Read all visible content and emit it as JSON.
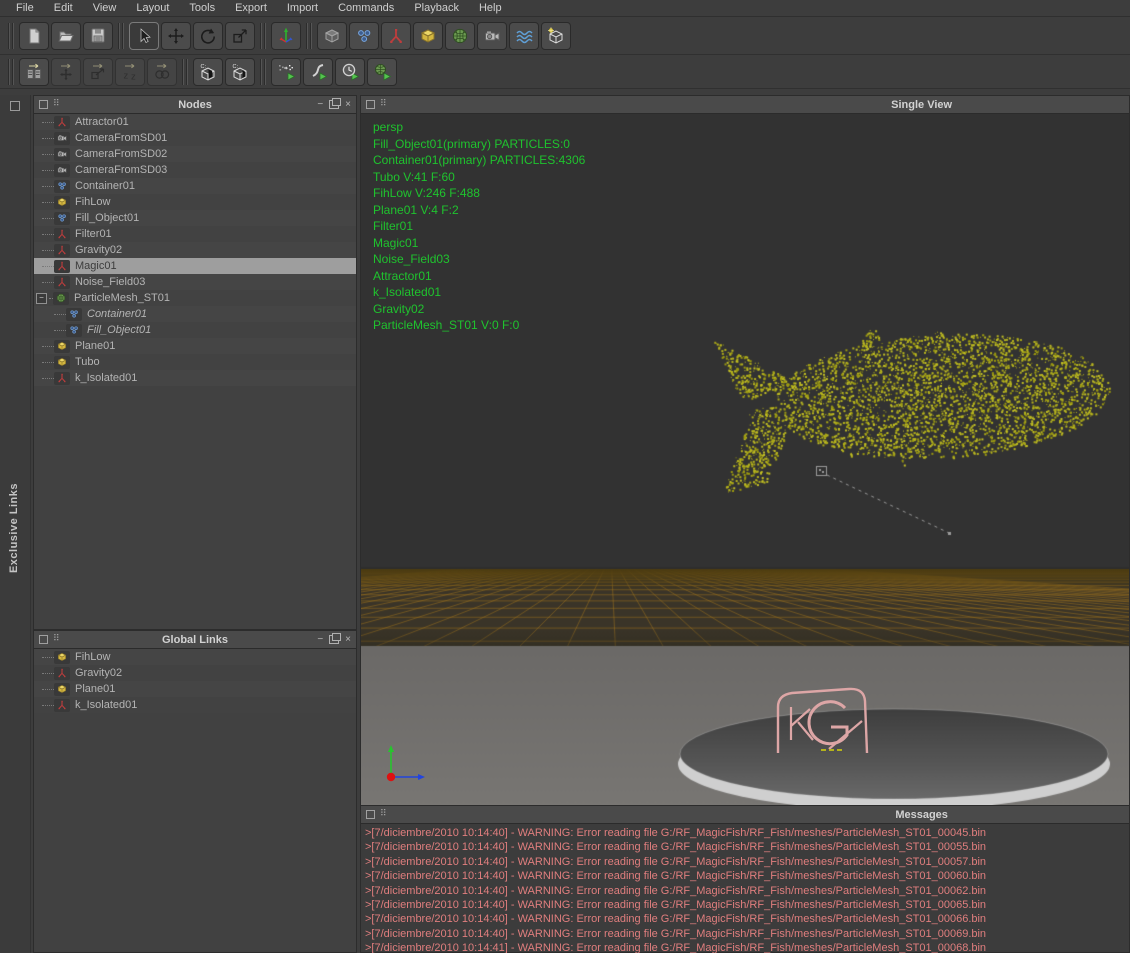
{
  "menu": {
    "items": [
      "File",
      "Edit",
      "View",
      "Layout",
      "Tools",
      "Export",
      "Import",
      "Commands",
      "Playback",
      "Help"
    ]
  },
  "toolbar_row1": {
    "groups": [
      {
        "buttons": [
          {
            "icon": "new-page",
            "name": "new-scene"
          },
          {
            "icon": "open-folder",
            "name": "open-scene"
          },
          {
            "icon": "save",
            "name": "save-scene"
          }
        ]
      },
      {
        "buttons": [
          {
            "icon": "select",
            "name": "select-tool",
            "pressed": true
          },
          {
            "icon": "move",
            "name": "move-tool"
          },
          {
            "icon": "rotate",
            "name": "rotate-tool"
          },
          {
            "icon": "scale",
            "name": "scale-tool"
          }
        ]
      },
      {
        "buttons": [
          {
            "icon": "axes",
            "name": "gizmo-tool"
          }
        ]
      },
      {
        "buttons": [
          {
            "icon": "cube-gray",
            "name": "add-null"
          },
          {
            "icon": "particles",
            "name": "add-particles"
          },
          {
            "icon": "daemon",
            "name": "add-daemon"
          },
          {
            "icon": "cube-yellow",
            "name": "add-object"
          },
          {
            "icon": "sphere-green",
            "name": "add-mesh"
          },
          {
            "icon": "camera",
            "name": "add-camera"
          },
          {
            "icon": "waves",
            "name": "add-realwave"
          },
          {
            "icon": "cube-wire",
            "name": "add-domain"
          }
        ]
      }
    ]
  },
  "toolbar_row2": {
    "groups": [
      {
        "buttons": [
          {
            "icon": "copy-table",
            "name": "copy-table"
          },
          {
            "icon": "copy-move",
            "name": "copy-move",
            "disabled": true
          },
          {
            "icon": "copy-scale",
            "name": "copy-scale",
            "disabled": true
          },
          {
            "icon": "copy-zz",
            "name": "copy-z",
            "disabled": true
          },
          {
            "icon": "copy-circles",
            "name": "copy-rings",
            "disabled": true
          }
        ]
      },
      {
        "buttons": [
          {
            "icon": "cache1",
            "name": "cache-left"
          },
          {
            "icon": "cache2",
            "name": "cache-right"
          }
        ]
      },
      {
        "buttons": [
          {
            "icon": "sim-parts",
            "name": "simulate-particles"
          },
          {
            "icon": "sim-curve",
            "name": "simulate-curve"
          },
          {
            "icon": "sim-clock",
            "name": "simulate-timed"
          },
          {
            "icon": "sim-mesh",
            "name": "simulate-mesh"
          }
        ]
      }
    ]
  },
  "side": {
    "exclusive_links_label": "Exclusive Links"
  },
  "nodes_panel": {
    "title": "Nodes",
    "items": [
      {
        "label": "Attractor01",
        "icon": "daemon"
      },
      {
        "label": "CameraFromSD01",
        "icon": "camera"
      },
      {
        "label": "CameraFromSD02",
        "icon": "camera"
      },
      {
        "label": "CameraFromSD03",
        "icon": "camera"
      },
      {
        "label": "Container01",
        "icon": "particles"
      },
      {
        "label": "FihLow",
        "icon": "cube-yellow"
      },
      {
        "label": "Fill_Object01",
        "icon": "particles"
      },
      {
        "label": "Filter01",
        "icon": "daemon"
      },
      {
        "label": "Gravity02",
        "icon": "daemon"
      },
      {
        "label": "Magic01",
        "icon": "daemon",
        "selected": true
      },
      {
        "label": "Noise_Field03",
        "icon": "daemon"
      },
      {
        "label": "ParticleMesh_ST01",
        "icon": "sphere-green",
        "expander": "-"
      },
      {
        "label": "Container01",
        "icon": "particles",
        "italic": true,
        "indent": 1
      },
      {
        "label": "Fill_Object01",
        "icon": "particles",
        "italic": true,
        "indent": 1
      },
      {
        "label": "Plane01",
        "icon": "cube-yellow"
      },
      {
        "label": "Tubo",
        "icon": "cube-yellow"
      },
      {
        "label": "k_Isolated01",
        "icon": "daemon"
      }
    ]
  },
  "global_links_panel": {
    "title": "Global Links",
    "items": [
      {
        "label": "FihLow",
        "icon": "cube-yellow"
      },
      {
        "label": "Gravity02",
        "icon": "daemon"
      },
      {
        "label": "Plane01",
        "icon": "cube-yellow"
      },
      {
        "label": "k_Isolated01",
        "icon": "daemon"
      }
    ]
  },
  "viewport": {
    "title": "Single View",
    "hud_lines": [
      "persp",
      "Fill_Object01(primary) PARTICLES:0",
      "Container01(primary) PARTICLES:4306",
      "Tubo V:41 F:60",
      "FihLow V:246 F:488",
      "Plane01 V:4 F:2",
      "Filter01",
      "Magic01",
      "Noise_Field03",
      "Attractor01",
      "k_Isolated01",
      "Gravity02",
      "ParticleMesh_ST01 V:0 F:0"
    ]
  },
  "messages_panel": {
    "title": "Messages",
    "lines": [
      ">[7/diciembre/2010 10:14:40] - WARNING: Error reading file G:/RF_MagicFish/RF_Fish/meshes/ParticleMesh_ST01_00045.bin",
      ">[7/diciembre/2010 10:14:40] - WARNING: Error reading file G:/RF_MagicFish/RF_Fish/meshes/ParticleMesh_ST01_00055.bin",
      ">[7/diciembre/2010 10:14:40] - WARNING: Error reading file G:/RF_MagicFish/RF_Fish/meshes/ParticleMesh_ST01_00057.bin",
      ">[7/diciembre/2010 10:14:40] - WARNING: Error reading file G:/RF_MagicFish/RF_Fish/meshes/ParticleMesh_ST01_00060.bin",
      ">[7/diciembre/2010 10:14:40] - WARNING: Error reading file G:/RF_MagicFish/RF_Fish/meshes/ParticleMesh_ST01_00062.bin",
      ">[7/diciembre/2010 10:14:40] - WARNING: Error reading file G:/RF_MagicFish/RF_Fish/meshes/ParticleMesh_ST01_00065.bin",
      ">[7/diciembre/2010 10:14:40] - WARNING: Error reading file G:/RF_MagicFish/RF_Fish/meshes/ParticleMesh_ST01_00066.bin",
      ">[7/diciembre/2010 10:14:40] - WARNING: Error reading file G:/RF_MagicFish/RF_Fish/meshes/ParticleMesh_ST01_00069.bin",
      ">[7/diciembre/2010 10:14:41] - WARNING: Error reading file G:/RF_MagicFish/RF_Fish/meshes/ParticleMesh_ST01_00068.bin"
    ]
  },
  "colors": {
    "hud_green": "#1fc32e",
    "warning_red": "#e07e7e",
    "particle_yellow": "#b6b41e",
    "wire_pink": "#dda6a6",
    "grid_brown": "#a07319",
    "selection_gray": "#9e9e9e"
  }
}
